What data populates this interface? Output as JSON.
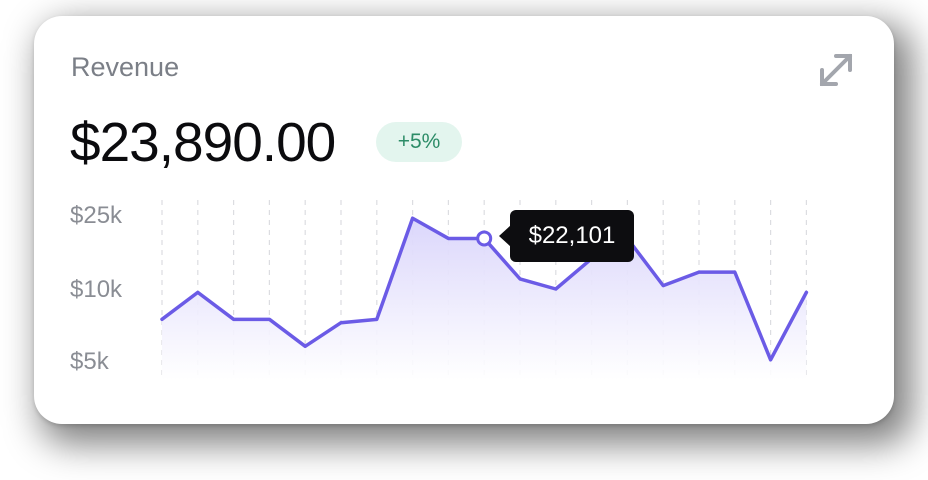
{
  "widget": {
    "title": "Revenue",
    "amount": "$23,890.00",
    "change_badge": "+5%",
    "expand_icon": "expand-arrows-icon"
  },
  "colors": {
    "line": "#6b5be6",
    "fill_top": "#d9d4fb",
    "badge_bg": "#e3f5ee",
    "badge_text": "#2c8c67",
    "tooltip_bg": "#0d0d10"
  },
  "tooltip": {
    "label": "$22,101",
    "index": 9
  },
  "chart_data": {
    "type": "area",
    "title": "",
    "xlabel": "",
    "ylabel": "",
    "y_ticks": [
      "$25k",
      "$10k",
      "$5k"
    ],
    "grid": "vertical dashed",
    "series": [
      {
        "values": [
          12,
          16,
          12,
          12,
          8,
          11.5,
          12,
          27,
          24,
          24,
          18,
          16.5,
          21,
          24,
          17,
          19,
          19,
          6,
          16
        ]
      }
    ]
  }
}
